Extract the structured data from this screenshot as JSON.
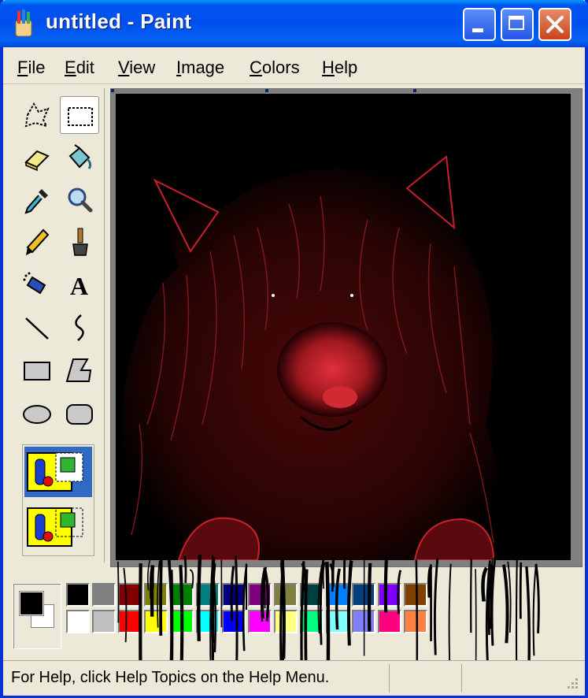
{
  "window": {
    "title": "untitled - Paint"
  },
  "menu": [
    {
      "label": "File",
      "key": "F",
      "rest": "ile"
    },
    {
      "label": "Edit",
      "key": "E",
      "rest": "dit"
    },
    {
      "label": "View",
      "key": "V",
      "rest": "iew"
    },
    {
      "label": "Image",
      "key": "I",
      "rest": "mage"
    },
    {
      "label": "Colors",
      "key": "C",
      "rest": "olors"
    },
    {
      "label": "Help",
      "key": "H",
      "rest": "elp"
    }
  ],
  "tools": [
    "free-form-select-icon",
    "select-icon",
    "eraser-icon",
    "fill-bucket-icon",
    "pick-color-icon",
    "magnifier-icon",
    "pencil-icon",
    "brush-icon",
    "airbrush-icon",
    "text-icon",
    "line-icon",
    "curve-icon",
    "rectangle-icon",
    "polygon-icon",
    "ellipse-icon",
    "rounded-rectangle-icon"
  ],
  "selected_tool": "select-icon",
  "text_tool_glyph": "A",
  "colors": {
    "foreground": "#000000",
    "background": "#ffffff",
    "palette_top": [
      "#000000",
      "#808080",
      "#800000",
      "#808000",
      "#008000",
      "#008080",
      "#000080",
      "#800080",
      "#808040",
      "#004040",
      "#0080ff",
      "#004080",
      "#8000ff",
      "#804000"
    ],
    "palette_bottom": [
      "#ffffff",
      "#c0c0c0",
      "#ff0000",
      "#ffff00",
      "#00ff00",
      "#00ffff",
      "#0000ff",
      "#ff00ff",
      "#ffff80",
      "#00ff80",
      "#80ffff",
      "#8080ff",
      "#ff0080",
      "#ff8040"
    ],
    "title_bar": "#0054e3",
    "drawing_red": "#c8202a"
  },
  "status": {
    "text": "For Help, click Help Topics on the Help Menu."
  }
}
